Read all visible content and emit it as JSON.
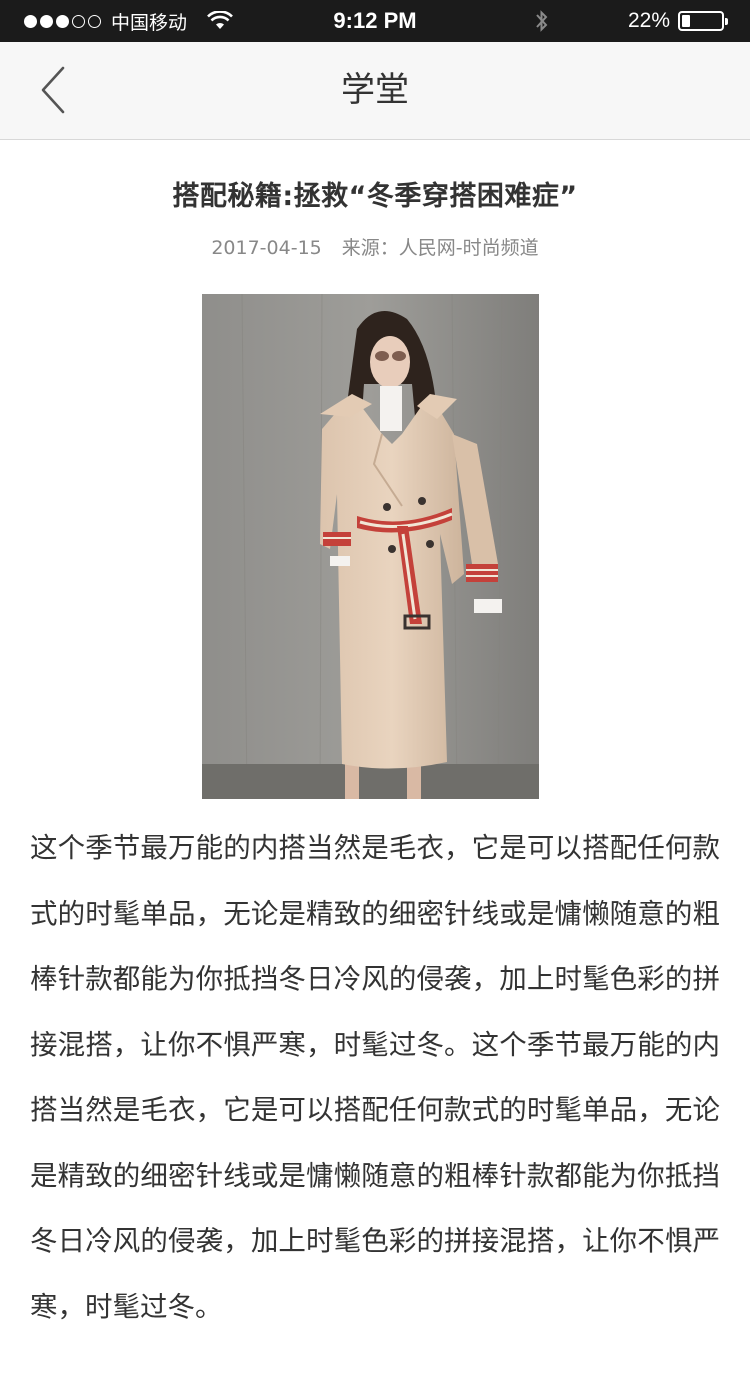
{
  "status_bar": {
    "carrier": "中国移动",
    "signal_filled": 3,
    "signal_total": 5,
    "time": "9:12 PM",
    "battery_percent": "22%",
    "battery_level": 0.22
  },
  "nav": {
    "back_icon": "chevron-left-icon",
    "title": "学堂"
  },
  "article": {
    "title": "搭配秘籍:拯救“冬季穿搭困难症”",
    "date": "2017-04-15",
    "source": "来源：人民网-时尚频道",
    "image": "photo of woman in beige trench coat with red-white striped belt",
    "body": "这个季节最万能的内搭当然是毛衣，它是可以搭配任何款式的时髦单品，无论是精致的细密针线或是慵懒随意的粗棒针款都能为你抵挡冬日冷风的侵袭，加上时髦色彩的拼接混搭，让你不惧严寒，时髦过冬。这个季节最万能的内搭当然是毛衣，它是可以搭配任何款式的时髦单品，无论是精致的细密针线或是慵懒随意的粗棒针款都能为你抵挡冬日冷风的侵袭，加上时髦色彩的拼接混搭，让你不惧严寒，时髦过冬。"
  },
  "colors": {
    "status_bar_bg": "#1b1b1b",
    "nav_bg": "#f7f7f7",
    "text": "#333333",
    "meta_text": "#888888"
  }
}
